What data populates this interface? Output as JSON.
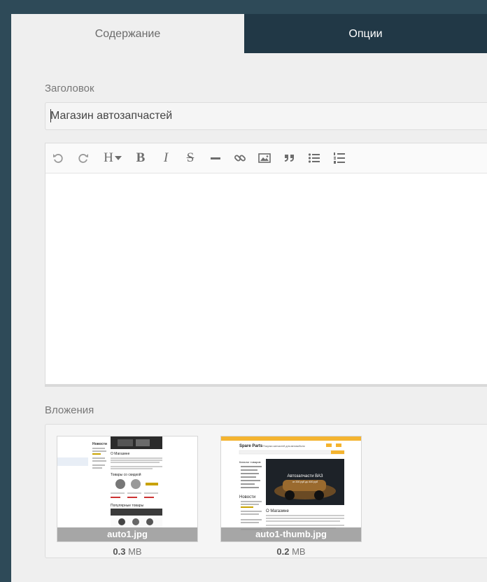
{
  "tabs": [
    {
      "label": "Содержание",
      "active": true
    },
    {
      "label": "Опции",
      "active": false
    }
  ],
  "title_field": {
    "label": "Заголовок",
    "value": "Магазин автозапчастей"
  },
  "editor": {
    "toolbar": [
      "undo-icon",
      "redo-icon",
      "heading-icon",
      "bold-icon",
      "italic-icon",
      "strikethrough-icon",
      "horizontal-rule-icon",
      "link-icon",
      "image-icon",
      "quote-icon",
      "bulleted-list-icon",
      "numbered-list-icon"
    ],
    "heading_glyph": "H",
    "bold_glyph": "B",
    "italic_glyph": "I",
    "strike_glyph": "S",
    "body": ""
  },
  "attachments": {
    "label": "Вложения",
    "items": [
      {
        "name": "auto1.jpg",
        "size_value": "0.3",
        "size_unit": "MB",
        "preview": {
          "news_heading": "Новости",
          "about_heading": "О Магазине",
          "products_heading": "Товары со скидкой",
          "popular_heading": "Популярные товары"
        }
      },
      {
        "name": "auto1-thumb.jpg",
        "size_value": "0.2",
        "size_unit": "MB",
        "preview": {
          "logo": "Spare Parts",
          "tagline": "Покупки запчастей для автомобиля",
          "catalog_heading": "Каталог товаров",
          "news_heading": "Новости",
          "banner_title": "Автозапчасти ВАЗ",
          "banner_sub": "от 200 руб до 400 руб",
          "about_heading": "О Магазине"
        }
      }
    ]
  },
  "colors": {
    "frame": "#2e4a58",
    "active_tab_bg": "#213846",
    "panel_bg": "#efefef",
    "preview_accent": "#f4b430"
  }
}
